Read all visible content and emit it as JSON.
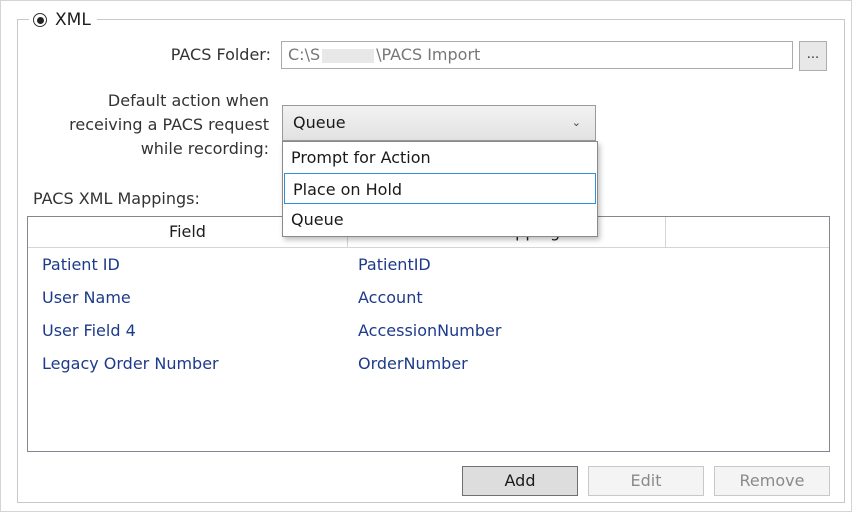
{
  "group": {
    "label": "XML",
    "selected": true
  },
  "pacs_folder": {
    "label": "PACS Folder:",
    "value_prefix": "C:\\S",
    "value_suffix": "\\PACS Import",
    "browse_label": "..."
  },
  "default_action": {
    "label_line1": "Default action when",
    "label_line2": "receiving a PACS request",
    "label_line3": "while recording:",
    "selected": "Queue",
    "options": [
      "Prompt for Action",
      "Place on Hold",
      "Queue"
    ],
    "highlighted_index": 1
  },
  "mappings": {
    "label": "PACS XML Mappings:",
    "columns": [
      "Field",
      "XML Mapping"
    ],
    "rows": [
      {
        "field": "Patient ID",
        "mapping": "PatientID"
      },
      {
        "field": "User Name",
        "mapping": "Account"
      },
      {
        "field": "User Field 4",
        "mapping": "AccessionNumber"
      },
      {
        "field": "Legacy Order Number",
        "mapping": "OrderNumber"
      }
    ]
  },
  "buttons": {
    "add": "Add",
    "edit": "Edit",
    "remove": "Remove"
  },
  "colors": {
    "link_text": "#1e3a8a",
    "highlight_border": "#2f8fdc"
  }
}
